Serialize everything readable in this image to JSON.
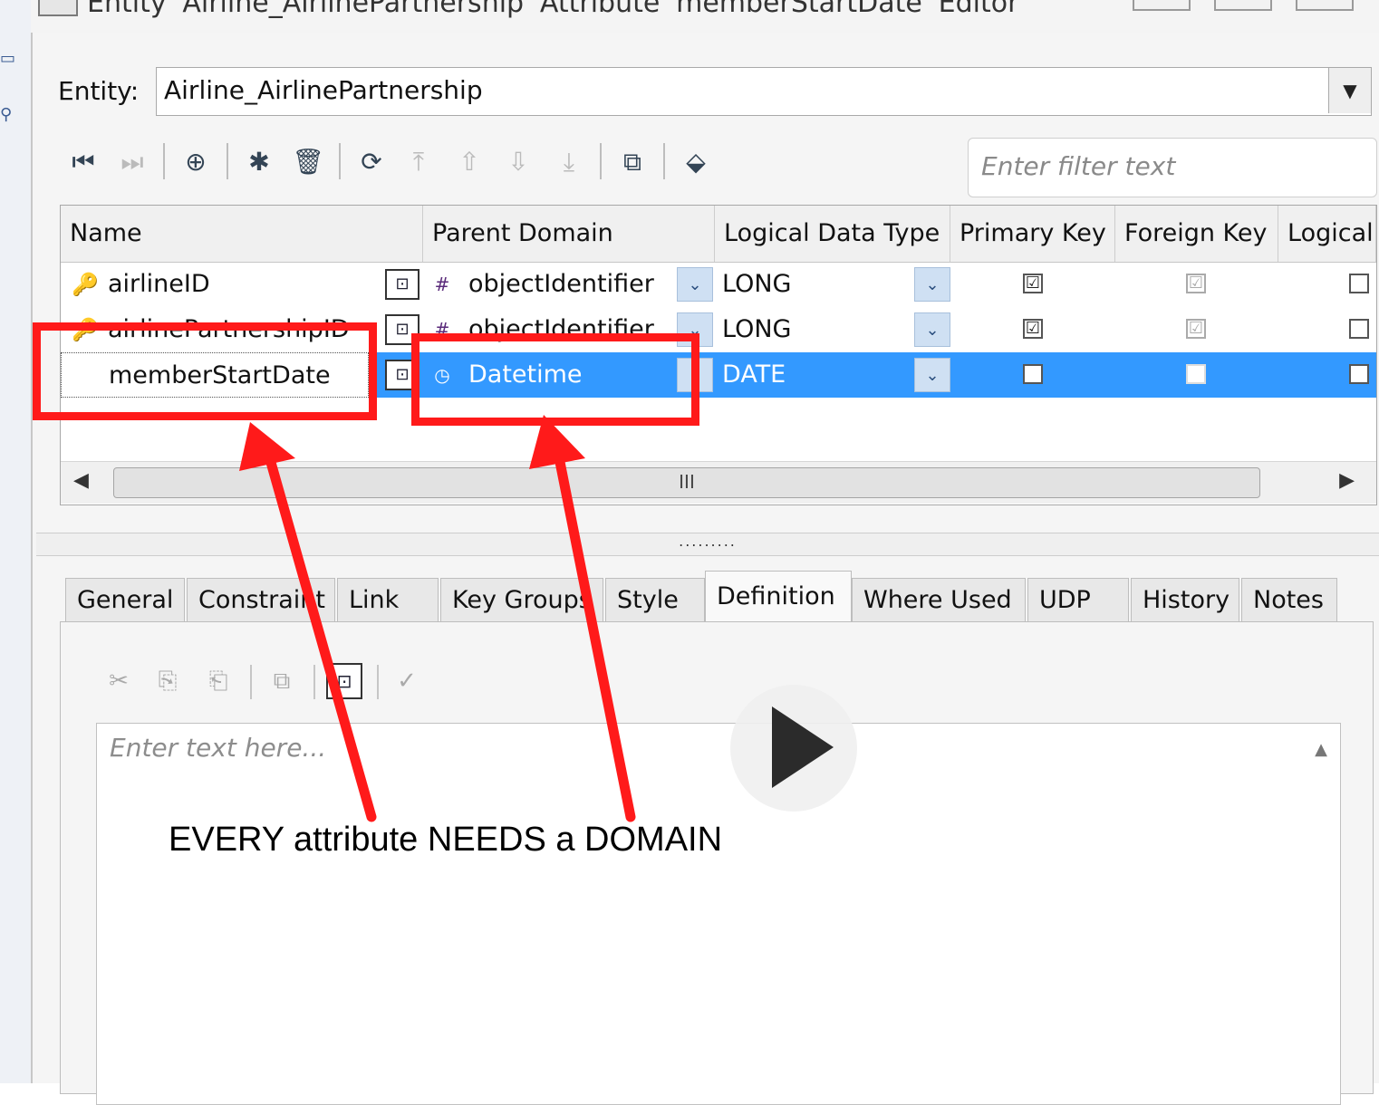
{
  "window": {
    "title": "Entity 'Airline_AirlinePartnership' Attribute 'memberStartDate' Editor"
  },
  "entity": {
    "label": "Entity:",
    "value": "Airline_AirlinePartnership"
  },
  "filter": {
    "placeholder": "Enter filter text"
  },
  "grid": {
    "columns": [
      "Name",
      "Parent Domain",
      "Logical Data Type",
      "Primary Key",
      "Foreign Key",
      "Logical"
    ],
    "rows": [
      {
        "name": "airlineID",
        "parent_domain": "objectIdentifier",
        "logical_type": "LONG",
        "primary_key": true,
        "foreign_key": true,
        "logical": false,
        "selected": false
      },
      {
        "name": "airlinePartnershipID",
        "parent_domain": "objectIdentifier",
        "logical_type": "LONG",
        "primary_key": true,
        "foreign_key": true,
        "logical": false,
        "selected": false
      },
      {
        "name": "memberStartDate",
        "parent_domain": "Datetime",
        "logical_type": "DATE",
        "primary_key": false,
        "foreign_key": false,
        "logical": false,
        "selected": true
      }
    ],
    "scroll_thumb": "III"
  },
  "tabs": [
    "General",
    "Constraint",
    "Link",
    "Key Groups",
    "Style",
    "Definition",
    "Where Used",
    "UDP",
    "History",
    "Notes"
  ],
  "active_tab": "Definition",
  "definition": {
    "placeholder": "Enter text here..."
  },
  "annotation": {
    "caption": "EVERY attribute NEEDS a DOMAIN",
    "color": "#ff1a1a"
  },
  "icons": {
    "check": "☑",
    "grid_dropdown": "⌄",
    "combo_dropdown": "▼"
  }
}
